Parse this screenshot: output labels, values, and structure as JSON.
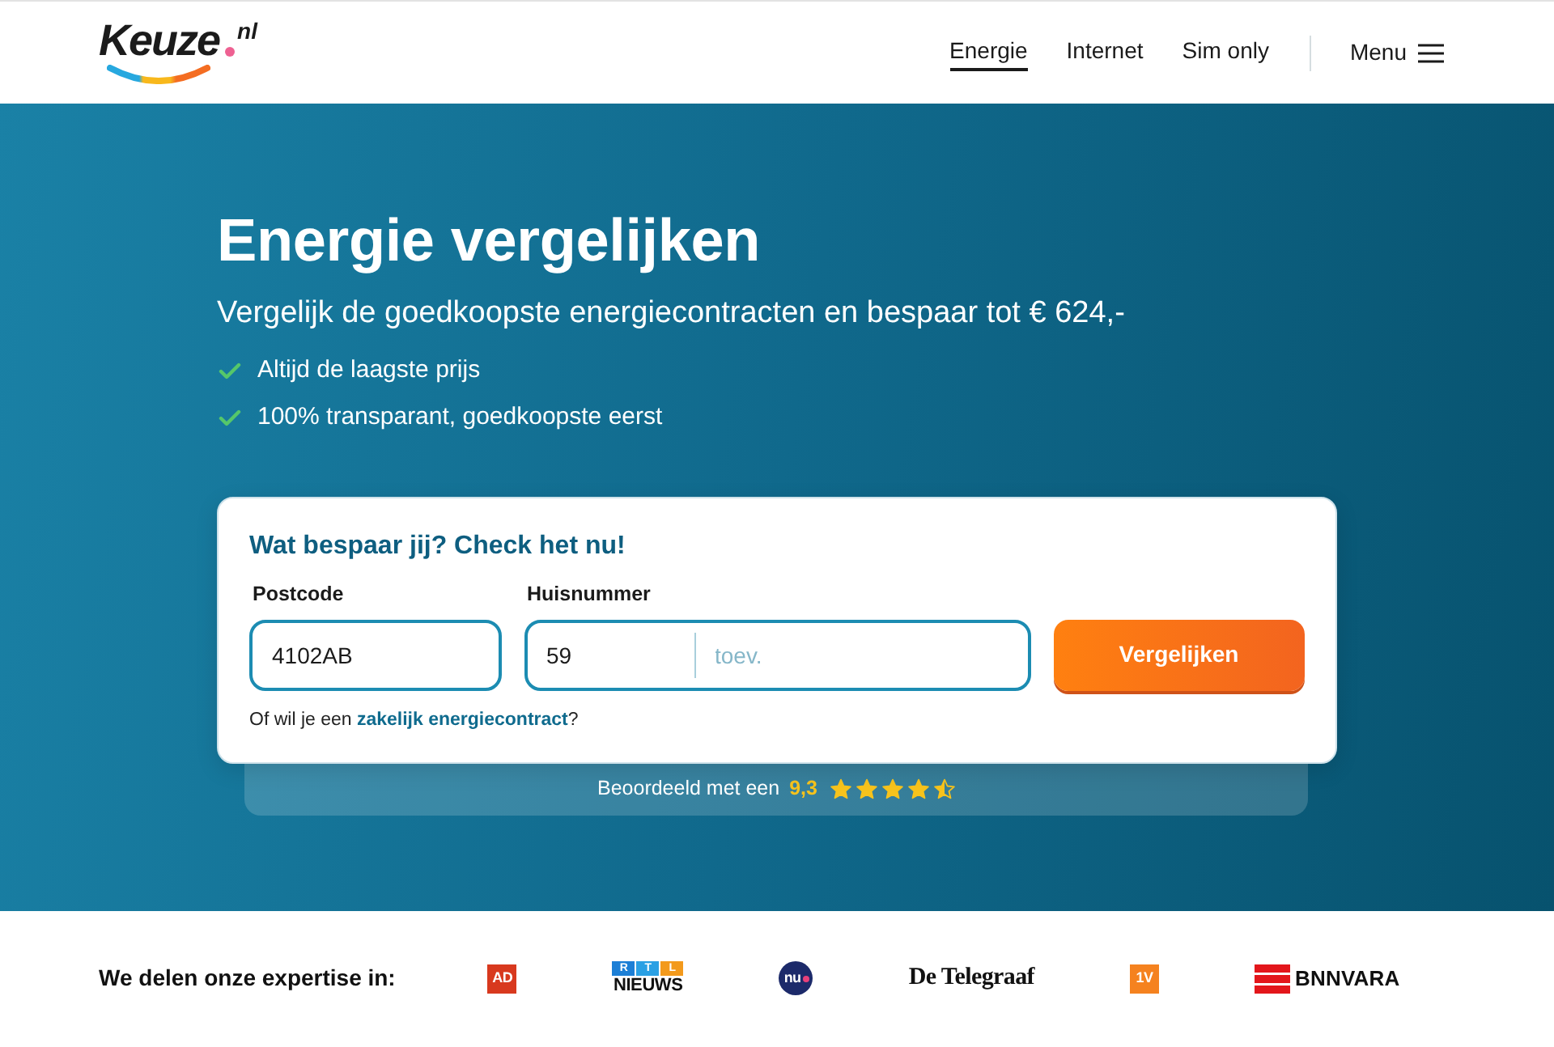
{
  "header": {
    "logo": {
      "name": "Keuze",
      "suffix": "nl"
    },
    "nav": [
      {
        "label": "Energie",
        "selected": true
      },
      {
        "label": "Internet",
        "selected": false
      },
      {
        "label": "Sim only",
        "selected": false
      }
    ],
    "menu": {
      "label": "Menu"
    }
  },
  "hero": {
    "title": "Energie vergelijken",
    "subtitle": "Vergelijk de goedkoopste energiecontracten en bespaar tot € 624,-",
    "benefits": [
      "Altijd de laagste prijs",
      "100% transparant, goedkoopste eerst"
    ]
  },
  "form": {
    "heading": "Wat bespaar jij? Check het nu!",
    "fields": [
      {
        "kind": "single",
        "label": "Postcode",
        "value": "4102AB"
      },
      {
        "kind": "split",
        "label": "Huisnummer",
        "value": "59",
        "addition": {
          "placeholder": "toev."
        }
      }
    ],
    "button": "Vergelijken",
    "note": {
      "text": "Of wil je een",
      "link": "zakelijk energiecontract",
      "tail": "?"
    }
  },
  "rating": {
    "text": "Beoordeeld met een",
    "score": "9,3",
    "stars": 4.5
  },
  "partners": {
    "title": "We delen onze expertise in:",
    "logos": [
      {
        "kind": "square",
        "text": "AD",
        "color": "#d8391e"
      },
      {
        "kind": "tiles",
        "letters": [
          "R",
          "T",
          "L"
        ],
        "text": "NIEUWS"
      },
      {
        "kind": "circle",
        "text": "nu"
      },
      {
        "kind": "blackletter",
        "text": "De Telegraaf"
      },
      {
        "kind": "square",
        "text": "1V",
        "color": "#f5821f"
      },
      {
        "kind": "stripes",
        "text": "BNNVARA"
      }
    ]
  }
}
